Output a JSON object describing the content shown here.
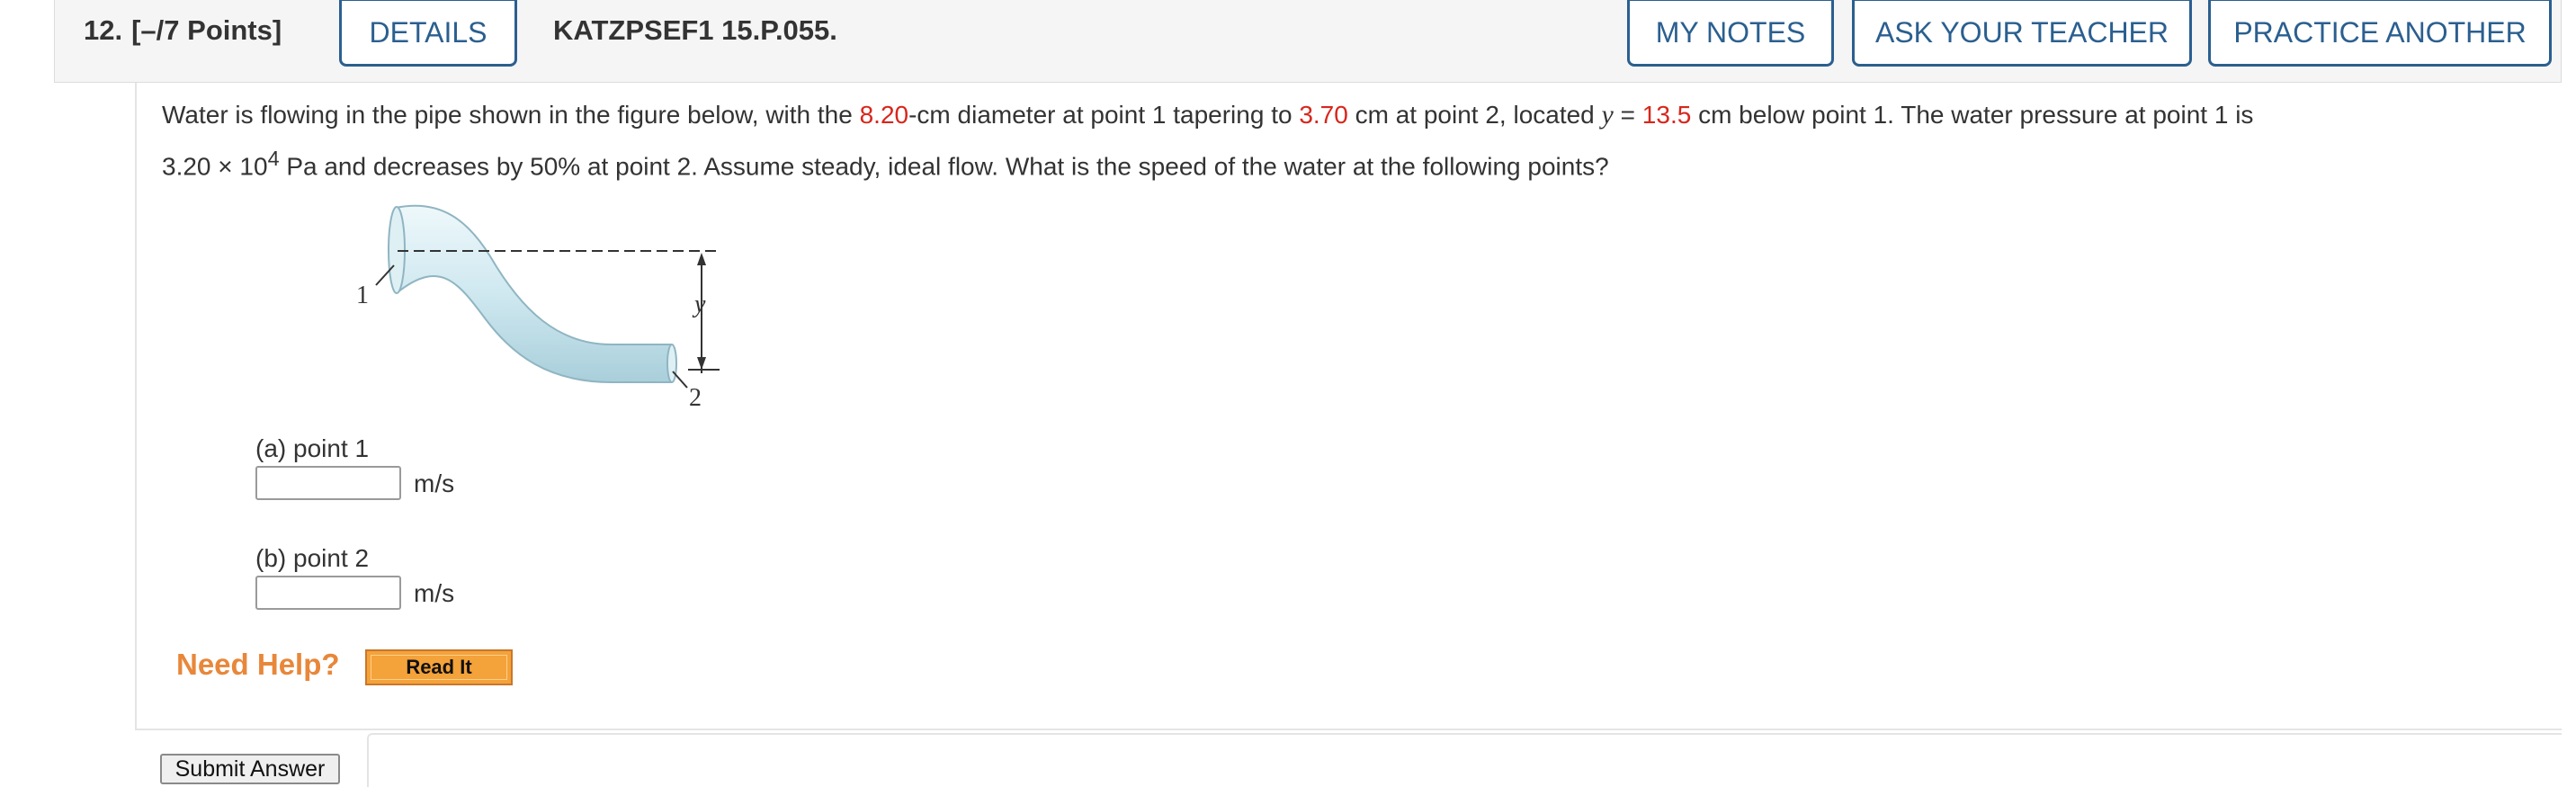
{
  "header": {
    "question_number": "12.",
    "points": "[–/7 Points]",
    "details_label": "DETAILS",
    "problem_code": "KATZPSEF1 15.P.055.",
    "my_notes_label": "MY NOTES",
    "ask_teacher_label": "ASK YOUR TEACHER",
    "practice_another_label": "PRACTICE ANOTHER"
  },
  "question": {
    "t1": "Water is flowing in the pipe shown in the figure below, with the ",
    "diameter1": "8.20",
    "t2": "-cm diameter at point 1 tapering to ",
    "diameter2": "3.70",
    "t3": " cm at point 2, located ",
    "y_var": "y",
    "t4": " = ",
    "y_value": "13.5",
    "t5": " cm  below point 1. The water pressure at point 1 is ",
    "pressure_coeff": "3.20 × 10",
    "pressure_exp": "4",
    "t6": " Pa and decreases by 50% at point 2. Assume steady, ideal flow. What is the speed of the water at the following points?"
  },
  "figure": {
    "label_point1": "1",
    "label_point2": "2",
    "label_y": "y"
  },
  "parts": [
    {
      "label": "(a) point 1",
      "unit": "m/s",
      "value": ""
    },
    {
      "label": "(b) point 2",
      "unit": "m/s",
      "value": ""
    }
  ],
  "help": {
    "need_help_label": "Need Help?",
    "read_it_label": "Read It"
  },
  "submit_label": "Submit Answer",
  "colors": {
    "accent_blue": "#2b5f8f",
    "given_value_red": "#d8261c",
    "need_help_orange": "#e8873a",
    "read_it_button": "#f4a23a",
    "pipe_fill": "#d9eef4"
  }
}
